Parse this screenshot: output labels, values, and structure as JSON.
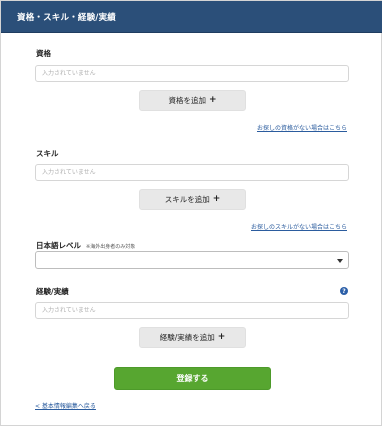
{
  "header": {
    "title": "資格・スキル・経験/実績"
  },
  "qualification": {
    "label": "資格",
    "placeholder": "入力されていません",
    "add_label": "資格を追加",
    "missing_link": "お探しの資格がない場合はこちら"
  },
  "skill": {
    "label": "スキル",
    "placeholder": "入力されていません",
    "add_label": "スキルを追加",
    "missing_link": "お探しのスキルがない場合はこちら"
  },
  "japanese": {
    "label": "日本語レベル",
    "note": "※海外出身者のみ対象",
    "selected": ""
  },
  "experience": {
    "label": "経験/実績",
    "placeholder": "入力されていません",
    "add_label": "経験/実績を追加"
  },
  "icons": {
    "plus": "+",
    "help": "?"
  },
  "actions": {
    "submit_label": "登録する",
    "back_link": "< 基本情報編集へ戻る"
  },
  "colors": {
    "header": "#2b4f79",
    "submit": "#57a630",
    "link": "#2b5c9e"
  }
}
